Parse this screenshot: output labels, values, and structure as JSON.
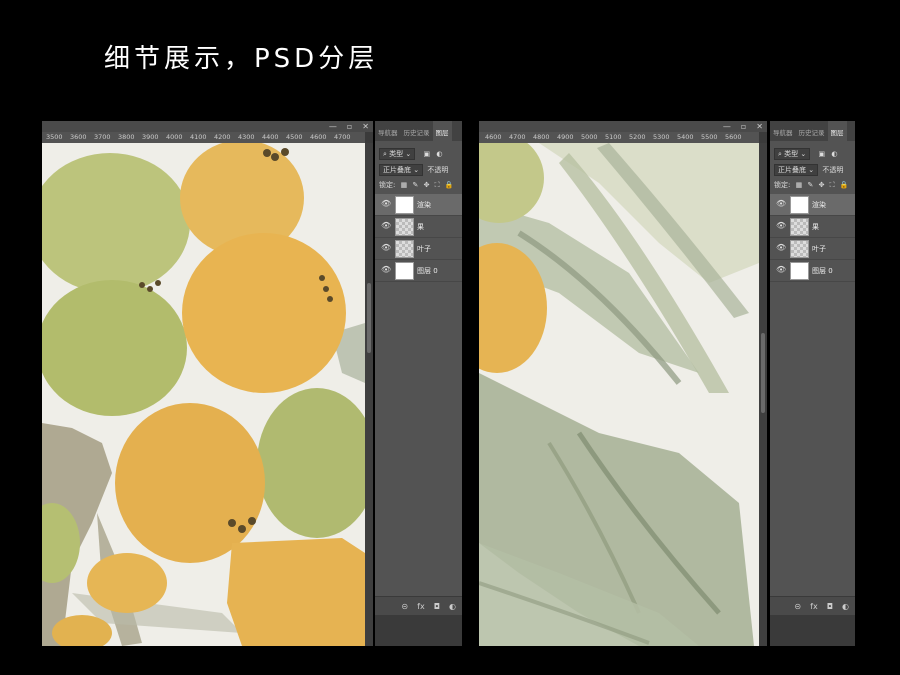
{
  "title": "细节展示，PSD分层",
  "window_controls": [
    "—",
    "▫",
    "✕"
  ],
  "left_window": {
    "ruler_ticks": [
      "3500",
      "3600",
      "3700",
      "3800",
      "3900",
      "4000",
      "4100",
      "4200",
      "4300",
      "4400",
      "4500",
      "4600",
      "4700"
    ]
  },
  "right_window": {
    "ruler_ticks": [
      "4600",
      "4700",
      "4800",
      "4900",
      "5000",
      "5100",
      "5200",
      "5300",
      "5400",
      "5500",
      "5600"
    ]
  },
  "layers_panel": {
    "tabs": [
      "导航器",
      "历史记录",
      "图层"
    ],
    "active_tab": "图层",
    "filter_label": "类型",
    "blend_mode": "正片叠底",
    "opacity_label": "不透明",
    "lock_label": "锁定:",
    "layers": [
      {
        "name": "渲染",
        "thumb": "white",
        "selected": true
      },
      {
        "name": "果",
        "thumb": "transparent",
        "selected": false
      },
      {
        "name": "叶子",
        "thumb": "transparent",
        "selected": false
      },
      {
        "name": "图层 0",
        "thumb": "white",
        "selected": false
      }
    ],
    "footer_icons": [
      "link-icon",
      "fx-icon",
      "mask-icon",
      "adjustment-icon"
    ],
    "footer_glyphs": [
      "⊝",
      "fx",
      "◘",
      "◐"
    ]
  },
  "colors": {
    "background": "#000000",
    "panel": "#535353",
    "fruit_orange": "#e3b04e",
    "fruit_green": "#b8c174",
    "leaf_green": "#9fab8e"
  }
}
